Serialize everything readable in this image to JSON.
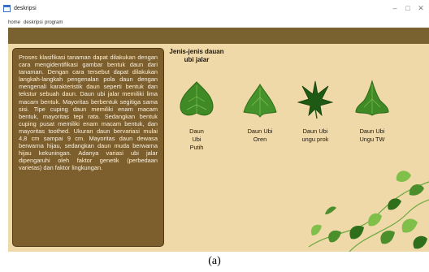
{
  "window": {
    "title": "deskripsi",
    "controls": [
      "–",
      "□",
      "✕"
    ]
  },
  "menu": {
    "items": [
      "home",
      "deskripsi",
      "program"
    ]
  },
  "description": {
    "text": "Proses klasifikasi tanaman dapat dilakukan dengan cara mengidentifikasi gambar bentuk daun dari tanaman. Dengan cara tersebut dapat dilakukan langkah-langkah pengenalan pola daun dengan mengenali karakteristik daun seperti bentuk dan tekstur sebuah daun. Daun ubi jalar memiliki lima macam bentuk. Mayoritas berbentuk segitiga sama sisi. Tipe cuping daun memiliki enam macam bentuk, mayoritas tepi rata. Sedangkan bentuk cuping pusat memiliki enam macam bentuk, dan mayoritas toothed. Ukuran daun bervariasi mulai 4,8 cm sampai 9 cm. Mayoritas daun dewasa berwarna hijau, sedangkan daun muda berwarna hijau kekuningan. Adanya variasi ubi jalar dipengaruhi oleh faktor genetik (perbedaan varietas) dan faktor lingkungan."
  },
  "heading": "Jenis-jenis dauan ubi jalar",
  "leaves": [
    {
      "label": "Daun\nUbi\nPutih",
      "icon": "heart-leaf-icon"
    },
    {
      "label": "Daun Ubi\nOren",
      "icon": "triangle-leaf-icon"
    },
    {
      "label": "Daun Ubi\nungu prok",
      "icon": "lobed-leaf-icon"
    },
    {
      "label": "Daun Ubi\nUngu TW",
      "icon": "pointed-leaf-icon"
    }
  ],
  "caption": "(a)",
  "colors": {
    "brown_bar": "#7a6130",
    "panel": "#7c5f2c",
    "background": "#efd9a8",
    "leaf_green": "#3f8a25"
  }
}
